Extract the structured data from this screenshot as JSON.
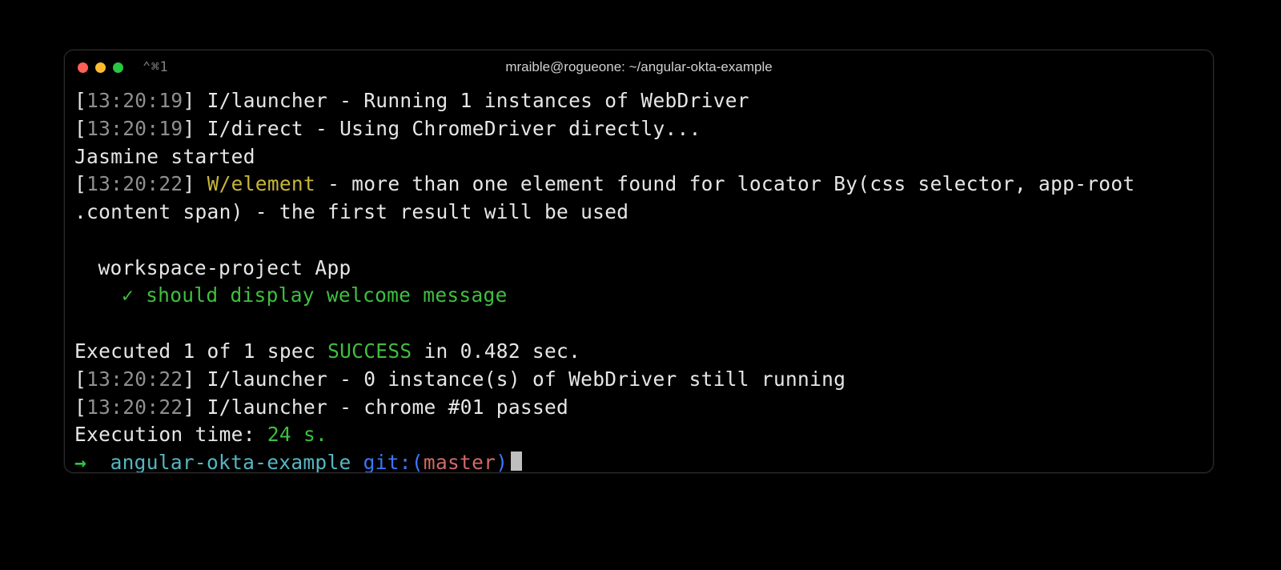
{
  "window": {
    "title": "mraible@rogueone: ~/angular-okta-example",
    "shortcut": "⌃⌘1"
  },
  "log": {
    "l1_ts": "13:20:19",
    "l1_cat": "I/launcher",
    "l1_msg": " - Running 1 instances of WebDriver",
    "l2_ts": "13:20:19",
    "l2_cat": "I/direct",
    "l2_msg": " - Using ChromeDriver directly...",
    "l3": "Jasmine started",
    "l4_ts": "13:20:22",
    "l4_cat": "W/element",
    "l4_msg": " - more than one element found for locator By(css selector, app-root .content span) - the first result will be used",
    "l5": "workspace-project App",
    "l6_mark": "✓ ",
    "l6_msg": "should display welcome message",
    "l7_a": "Executed 1 of 1 spec ",
    "l7_b": "SUCCESS",
    "l7_c": " in 0.482 sec.",
    "l8_ts": "13:20:22",
    "l8_cat": "I/launcher",
    "l8_msg": " - 0 instance(s) of WebDriver still running",
    "l9_ts": "13:20:22",
    "l9_cat": "I/launcher",
    "l9_msg": " - chrome #01 passed",
    "l10_a": "Execution time: ",
    "l10_b": "24 s."
  },
  "prompt": {
    "arrow": "→",
    "dir": "angular-okta-example",
    "git_label": "git:(",
    "branch": "master",
    "git_close": ")"
  }
}
